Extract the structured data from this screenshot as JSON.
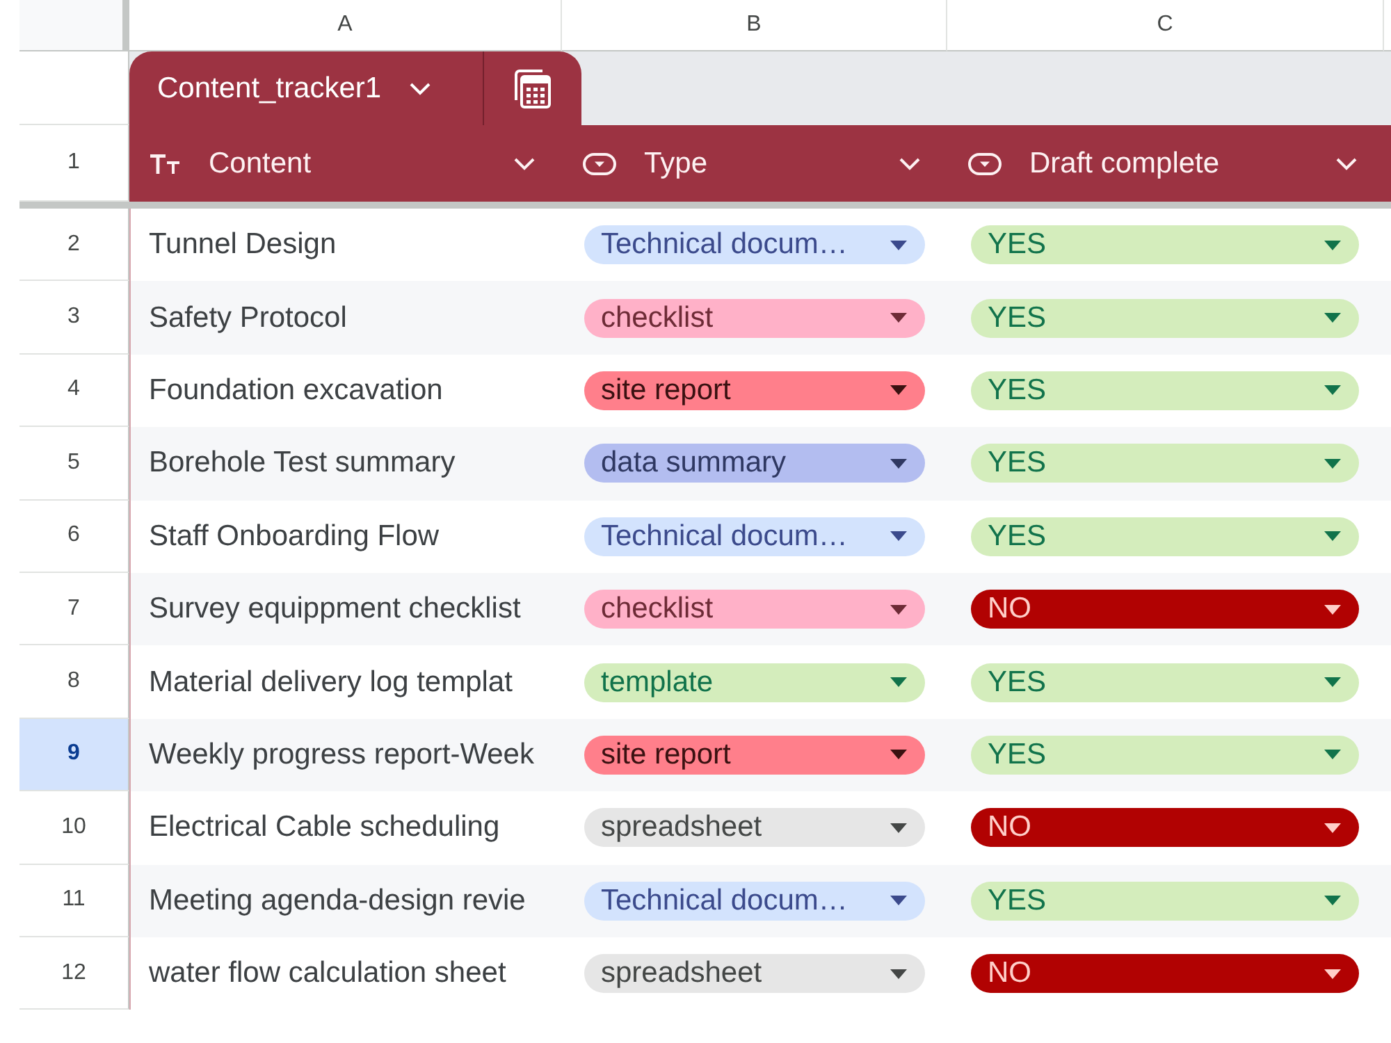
{
  "column_letters": [
    "A",
    "B",
    "C"
  ],
  "table_tab": {
    "name": "Content_tracker1"
  },
  "header_row": {
    "number": "1",
    "columns": [
      {
        "label": "Content",
        "kind": "text"
      },
      {
        "label": "Type",
        "kind": "dropdown"
      },
      {
        "label": "Draft complete",
        "kind": "dropdown"
      }
    ]
  },
  "rows": [
    {
      "number": "2",
      "selected": false,
      "content": "Tunnel Design",
      "type": {
        "label": "Technical docum…",
        "color": "#d3e3fd"
      },
      "draft_complete": {
        "label": "YES",
        "color": "#d4edbc"
      }
    },
    {
      "number": "3",
      "selected": false,
      "content": "Safety Protocol",
      "type": {
        "label": "checklist",
        "color": "#ffb1c8"
      },
      "draft_complete": {
        "label": "YES",
        "color": "#d4edbc"
      }
    },
    {
      "number": "4",
      "selected": false,
      "content": "Foundation excavation",
      "type": {
        "label": "site report",
        "color": "#ff7f8b"
      },
      "draft_complete": {
        "label": "YES",
        "color": "#d4edbc"
      }
    },
    {
      "number": "5",
      "selected": false,
      "content": "Borehole Test summary",
      "type": {
        "label": "data summary",
        "color": "#b3bdf0"
      },
      "draft_complete": {
        "label": "YES",
        "color": "#d4edbc"
      }
    },
    {
      "number": "6",
      "selected": false,
      "content": "Staff Onboarding Flow",
      "type": {
        "label": "Technical docum…",
        "color": "#d3e3fd"
      },
      "draft_complete": {
        "label": "YES",
        "color": "#d4edbc"
      }
    },
    {
      "number": "7",
      "selected": false,
      "content": "Survey equippment checklist",
      "type": {
        "label": "checklist",
        "color": "#ffb1c8"
      },
      "draft_complete": {
        "label": "NO",
        "color": "#b10202"
      }
    },
    {
      "number": "8",
      "selected": false,
      "content": "Material delivery log templat",
      "type": {
        "label": "template",
        "color": "#d4edbc"
      },
      "draft_complete": {
        "label": "YES",
        "color": "#d4edbc"
      }
    },
    {
      "number": "9",
      "selected": true,
      "content": "Weekly progress report-Week",
      "type": {
        "label": "site report",
        "color": "#ff7f8b"
      },
      "draft_complete": {
        "label": "YES",
        "color": "#d4edbc"
      }
    },
    {
      "number": "10",
      "selected": false,
      "content": "Electrical Cable scheduling",
      "type": {
        "label": "spreadsheet",
        "color": "#e6e6e6"
      },
      "draft_complete": {
        "label": "NO",
        "color": "#b10202"
      }
    },
    {
      "number": "11",
      "selected": false,
      "content": "Meeting agenda-design revie",
      "type": {
        "label": "Technical docum…",
        "color": "#d3e3fd"
      },
      "draft_complete": {
        "label": "YES",
        "color": "#d4edbc"
      }
    },
    {
      "number": "12",
      "selected": false,
      "content": "water flow calculation sheet",
      "type": {
        "label": "spreadsheet",
        "color": "#e6e6e6"
      },
      "draft_complete": {
        "label": "NO",
        "color": "#b10202"
      }
    }
  ]
}
